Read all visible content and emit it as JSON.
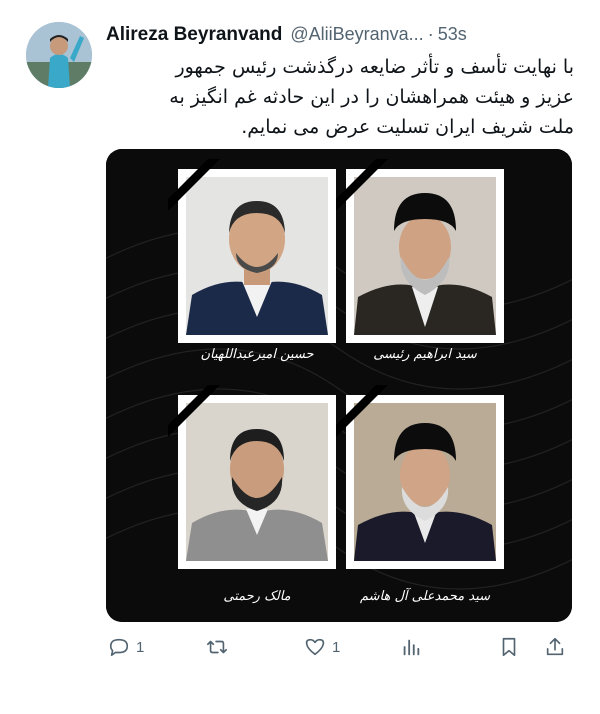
{
  "author": {
    "display_name": "Alireza Beyranvand",
    "handle": "@AliiBeyranva...",
    "separator": "·",
    "time": "53s"
  },
  "tweet": {
    "lines": [
      "با نهایت تأسف و تأثر ضایعه درگذشت رئیس جمهور",
      "عزیز و هیئت همراهشان را در این حادثه غم انگیز به",
      "ملت شریف ایران تسلیت عرض می نمایم."
    ]
  },
  "media": {
    "background": "#0b0b0b",
    "cards": [
      {
        "caption": "حسین امیرعبداللهیان"
      },
      {
        "caption": "سید ابراهیم رئیسی"
      },
      {
        "caption": "مالک رحمتی"
      },
      {
        "caption": "سید محمدعلی آل هاشم"
      }
    ]
  },
  "actions": {
    "reply_count": "1",
    "retweet_count": "",
    "like_count": "1",
    "icons": [
      "reply-icon",
      "retweet-icon",
      "like-icon",
      "views-icon",
      "bookmark-icon",
      "share-icon"
    ]
  },
  "colors": {
    "text": "#0f1419",
    "secondary": "#536471",
    "media_bg": "#0b0b0b"
  }
}
